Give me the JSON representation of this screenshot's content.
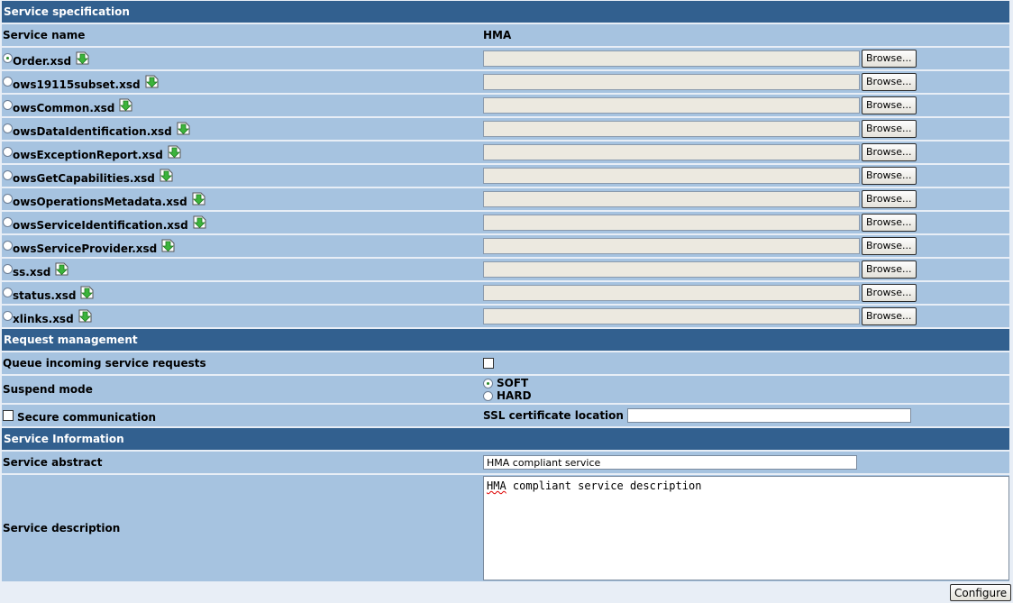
{
  "sections": {
    "service_spec": "Service specification",
    "request_mgmt": "Request management",
    "service_info": "Service Information"
  },
  "service_name": {
    "label": "Service name",
    "value": "HMA"
  },
  "browse_label": "Browse...",
  "files": [
    {
      "name": "Order.xsd",
      "selected": true
    },
    {
      "name": "ows19115subset.xsd",
      "selected": false
    },
    {
      "name": "owsCommon.xsd",
      "selected": false
    },
    {
      "name": "owsDataIdentification.xsd",
      "selected": false
    },
    {
      "name": "owsExceptionReport.xsd",
      "selected": false
    },
    {
      "name": "owsGetCapabilities.xsd",
      "selected": false
    },
    {
      "name": "owsOperationsMetadata.xsd",
      "selected": false
    },
    {
      "name": "owsServiceIdentification.xsd",
      "selected": false
    },
    {
      "name": "owsServiceProvider.xsd",
      "selected": false
    },
    {
      "name": "ss.xsd",
      "selected": false
    },
    {
      "name": "status.xsd",
      "selected": false
    },
    {
      "name": "xlinks.xsd",
      "selected": false
    }
  ],
  "request": {
    "queue_label": "Queue incoming service requests",
    "queue_checked": false,
    "suspend_label": "Suspend mode",
    "suspend_options": [
      "SOFT",
      "HARD"
    ],
    "suspend_selected": "SOFT",
    "secure_label": "Secure communication",
    "secure_checked": false,
    "ssl_label": "SSL certificate location",
    "ssl_value": ""
  },
  "info": {
    "abstract_label": "Service abstract",
    "abstract_value": "HMA compliant service",
    "description_label": "Service description",
    "description_word": "HMA",
    "description_rest": " compliant service description"
  },
  "configure_label": "Configure",
  "colors": {
    "header_bg": "#32608f",
    "row_bg": "#a6c3e0",
    "page_bg": "#e8eef6",
    "download_green": "#3cb43c"
  },
  "icons": {
    "download": "download-arrow-icon"
  }
}
